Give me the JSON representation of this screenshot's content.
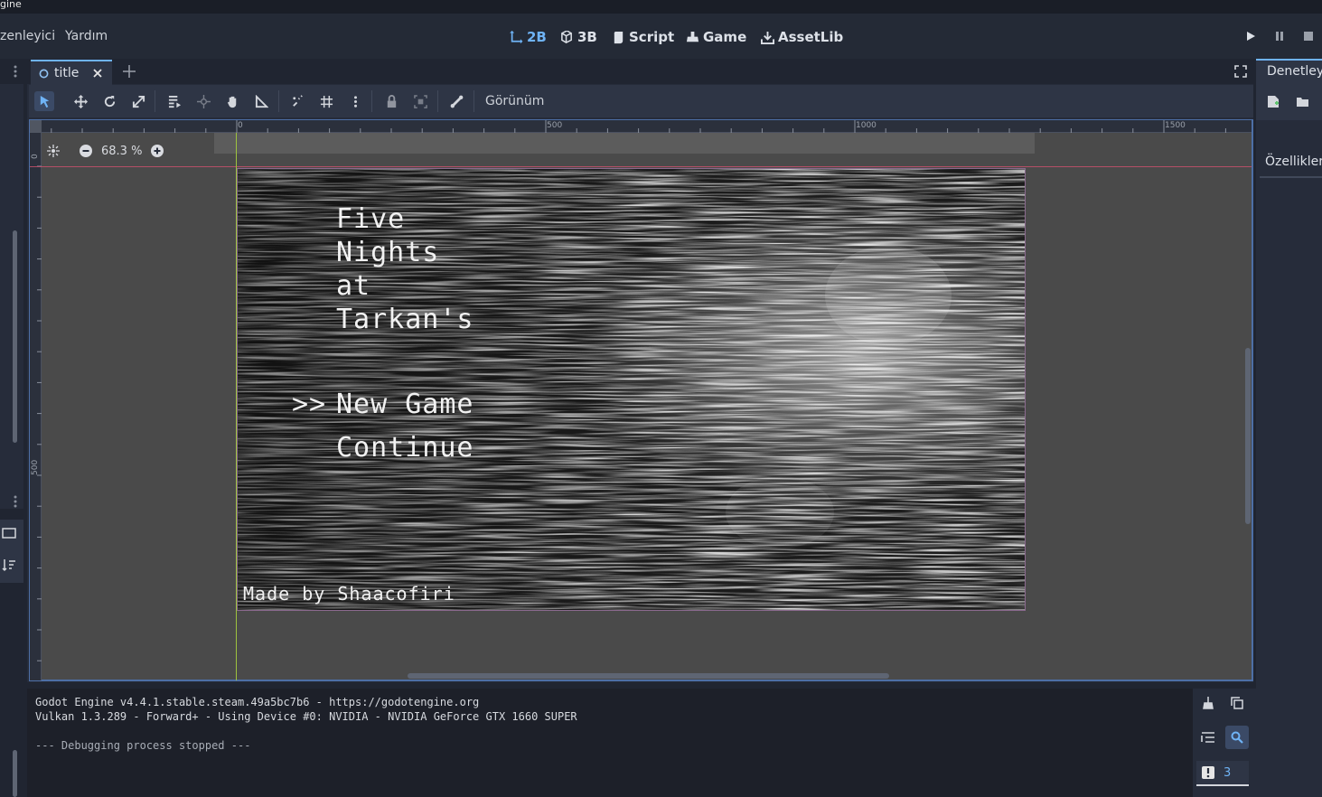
{
  "window": {
    "title_fragment": "gine"
  },
  "menu": {
    "items": [
      "zenleyici",
      "Yardım"
    ]
  },
  "workspaces": [
    {
      "label": "2B",
      "active": true
    },
    {
      "label": "3B",
      "active": false
    },
    {
      "label": "Script",
      "active": false
    },
    {
      "label": "Game",
      "active": false
    },
    {
      "label": "AssetLib",
      "active": false
    }
  ],
  "scene_tab": {
    "label": "title"
  },
  "toolbar": {
    "view_menu": "Görünüm"
  },
  "viewport": {
    "zoom": "68.3 %",
    "ruler_top": [
      "0",
      "500",
      "1000",
      "1500"
    ],
    "ruler_left": [
      "0",
      "500"
    ]
  },
  "game_scene": {
    "title_lines": [
      "Five",
      "Nights",
      "at",
      "Tarkan's"
    ],
    "cursor": ">>",
    "menu_new": "New Game",
    "menu_continue": "Continue",
    "credit": "Made by Shaacofiri"
  },
  "right_dock": {
    "tab_label": "Denetleyi",
    "section_label": "Özellikler"
  },
  "output": {
    "lines": [
      "Godot Engine v4.4.1.stable.steam.49a5bc7b6 - https://godotengine.org",
      "Vulkan 1.3.289 - Forward+ - Using Device #0: NVIDIA - NVIDIA GeForce GTX 1660 SUPER",
      "",
      "--- Debugging process stopped ---"
    ],
    "error_count": "3"
  },
  "colors": {
    "accent": "#6fb3f5",
    "guide_horizontal": "#c7506b",
    "guide_vertical": "#9ec33f",
    "viewport_border": "#4d6fa6"
  }
}
